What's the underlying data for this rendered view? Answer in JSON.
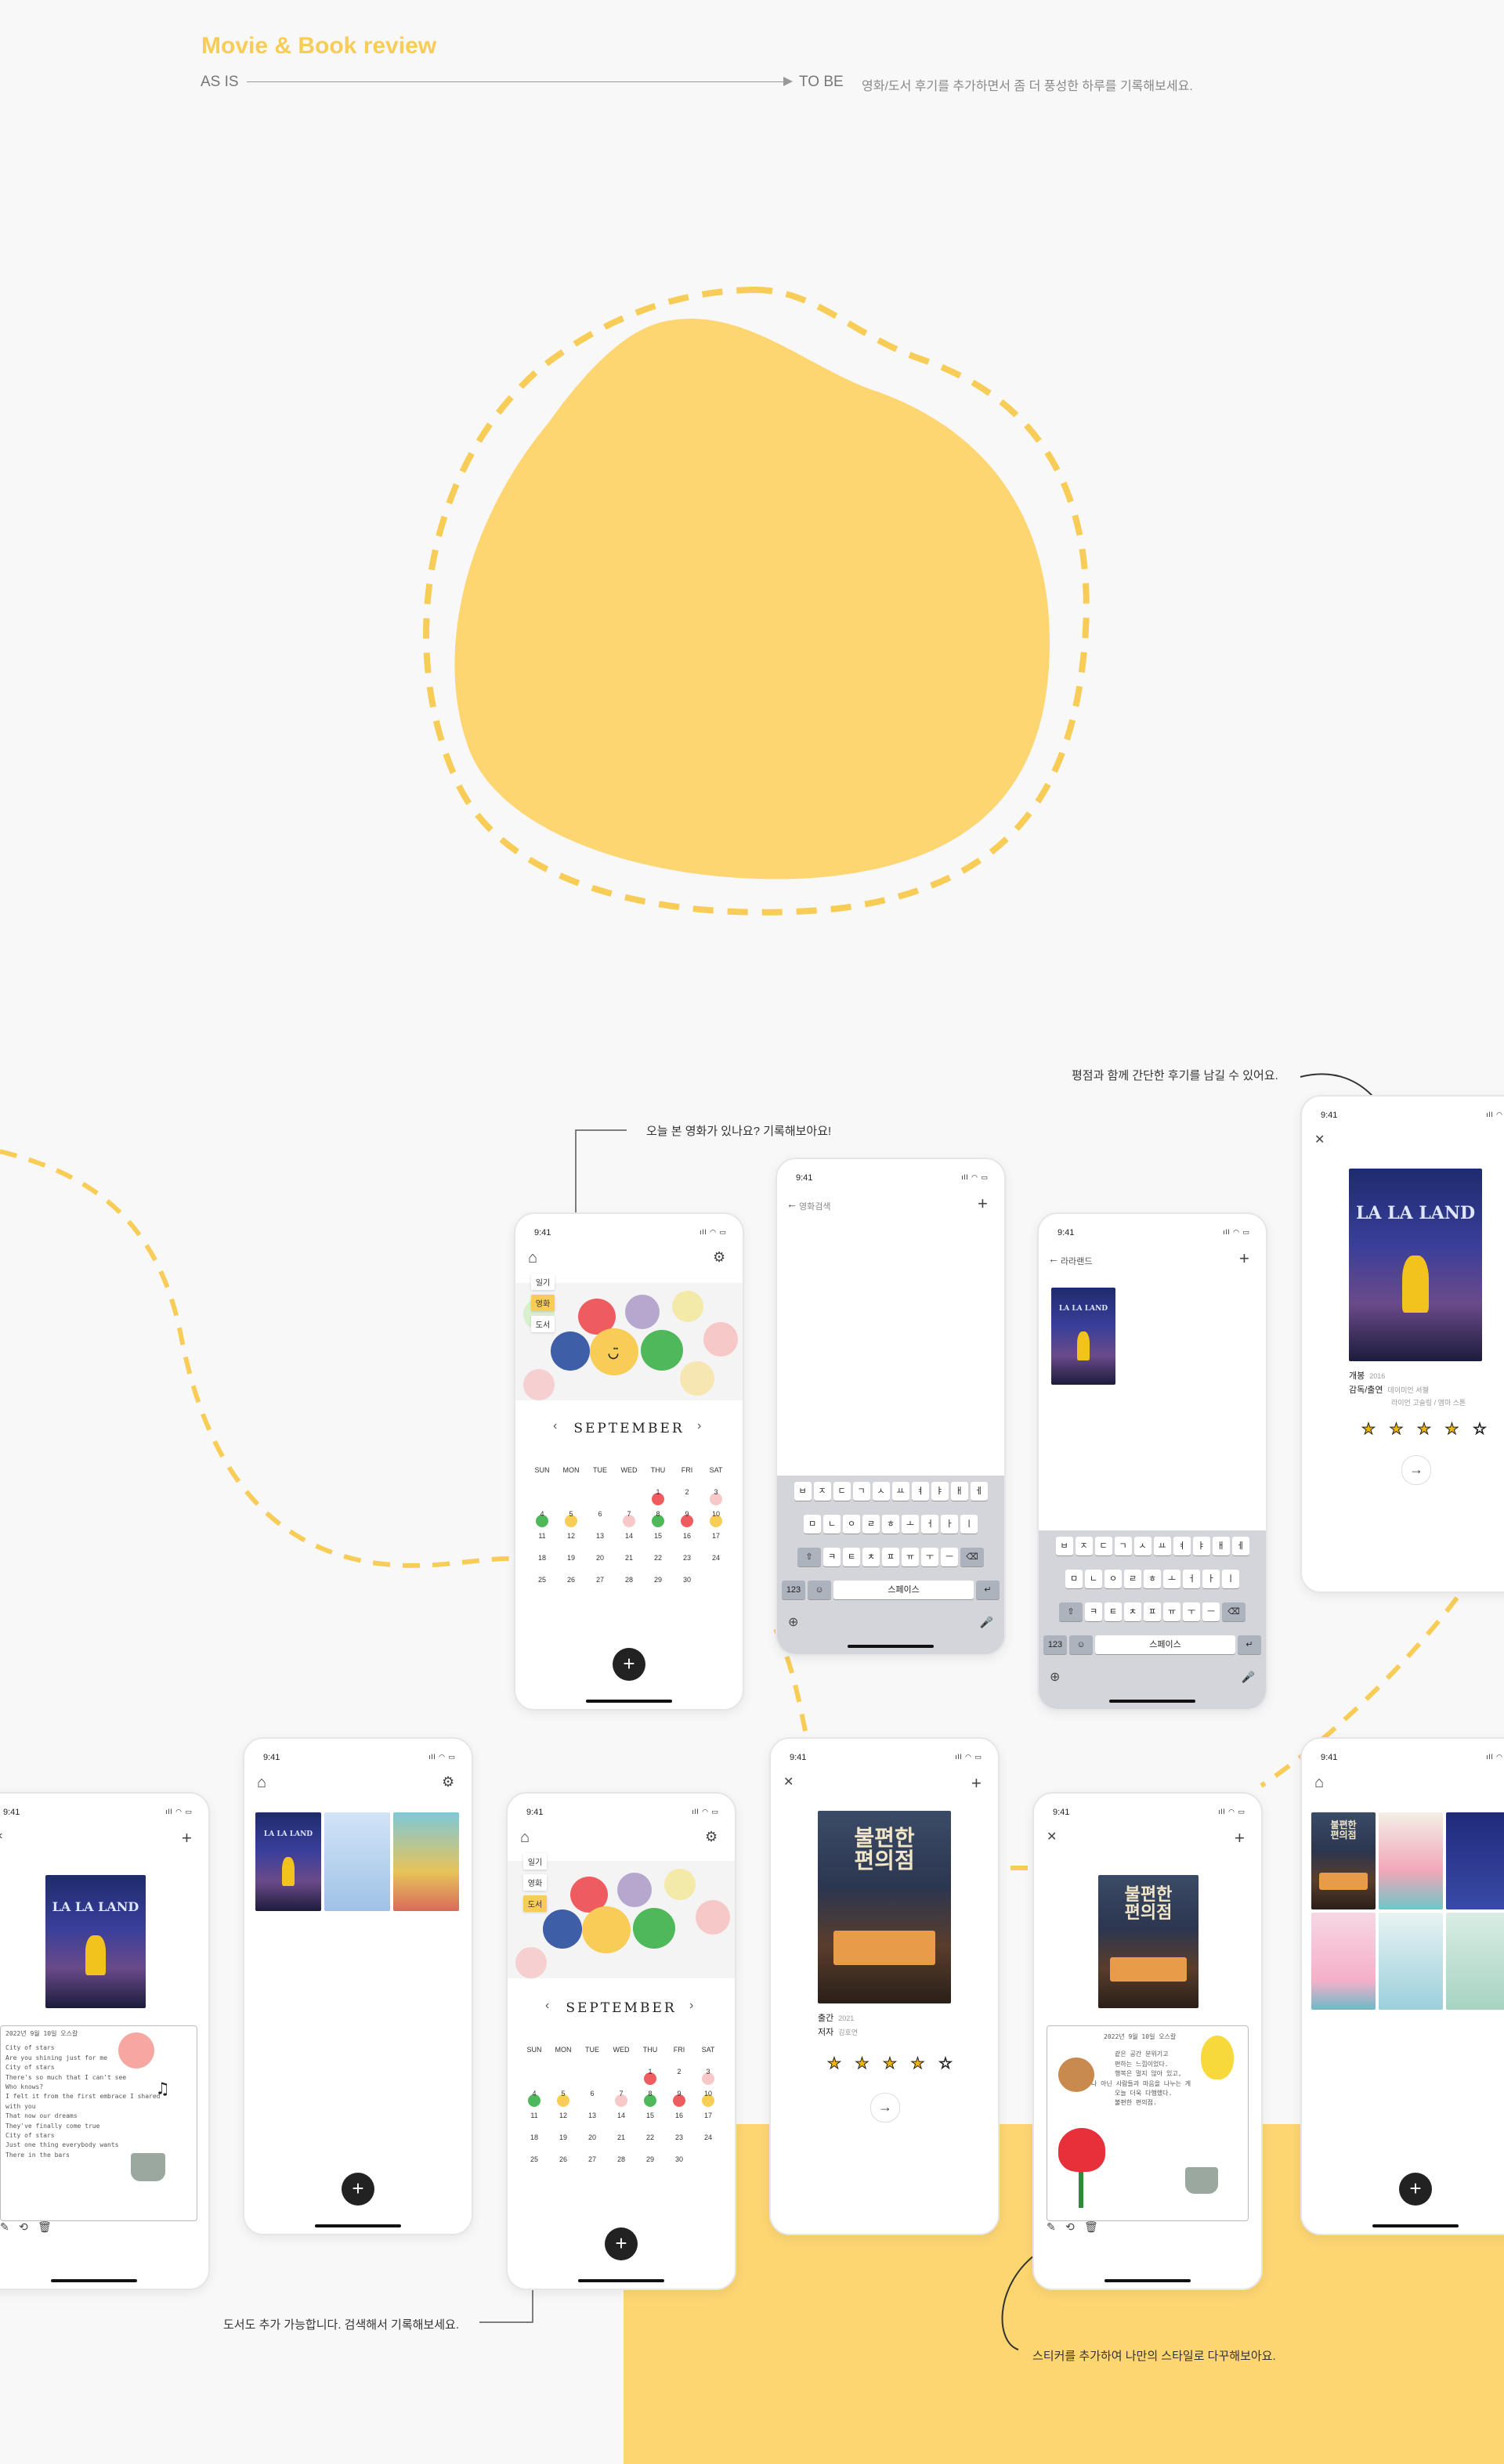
{
  "header": {
    "title": "Movie & Book review",
    "as_is": "AS IS",
    "to_be": "TO BE",
    "description": "영화/도서 후기를 추가하면서 좀 더 풍성한 하루를 기록해보세요."
  },
  "annotations": {
    "top_center": "오늘 본 영화가 있나요? 기록해보아요!",
    "top_right": "평점과 함께 간단한 후기를 남길 수 있어요.",
    "bottom_left": "도서도 추가 가능합니다. 검색해서 기록해보세요.",
    "bottom_right": "스티커를 추가하여 나만의 스타일로 다꾸해보아요."
  },
  "status": {
    "time": "9:41",
    "icons": "ıll ◠ ▭"
  },
  "calendar": {
    "month": "SEPTEMBER",
    "weekdays": [
      "SUN",
      "MON",
      "TUE",
      "WED",
      "THU",
      "FRI",
      "SAT"
    ],
    "weeks": [
      [
        "",
        "",
        "",
        "",
        "1",
        "2",
        "3"
      ],
      [
        "4",
        "5",
        "6",
        "7",
        "8",
        "9",
        "10"
      ],
      [
        "11",
        "12",
        "13",
        "14",
        "15",
        "16",
        "17"
      ],
      [
        "18",
        "19",
        "20",
        "21",
        "22",
        "23",
        "24"
      ],
      [
        "25",
        "26",
        "27",
        "28",
        "29",
        "30",
        ""
      ]
    ],
    "tabs": [
      "일기",
      "영화",
      "도서"
    ]
  },
  "search": {
    "movie_placeholder": "영화검색",
    "movie_query": "라라랜드"
  },
  "keyboard": {
    "row1": [
      "ㅂ",
      "ㅈ",
      "ㄷ",
      "ㄱ",
      "ㅅ",
      "ㅛ",
      "ㅕ",
      "ㅑ",
      "ㅐ",
      "ㅔ"
    ],
    "row2": [
      "ㅁ",
      "ㄴ",
      "ㅇ",
      "ㄹ",
      "ㅎ",
      "ㅗ",
      "ㅓ",
      "ㅏ",
      "ㅣ"
    ],
    "row3": [
      "⇧",
      "ㅋ",
      "ㅌ",
      "ㅊ",
      "ㅍ",
      "ㅠ",
      "ㅜ",
      "ㅡ",
      "⌫"
    ],
    "num": "123",
    "emoji": "☺",
    "space": "스페이스",
    "enter": "↵",
    "globe": "⊕",
    "mic": "🎤"
  },
  "movie": {
    "title_line": "LA LA LAND",
    "release_label": "개봉",
    "release_year": "2016",
    "cast_label": "감독/출연",
    "director": "데이미언 셔젤",
    "cast": "라이언 고슬링 / 엠마 스톤",
    "rating": "★ ★ ★ ★ ☆"
  },
  "book": {
    "title_line1": "불편한",
    "title_line2": "편의점",
    "published_label": "출간",
    "published_year": "2021",
    "author_label": "저자",
    "author": "김호연",
    "rating": "★ ★ ★ ★ ☆"
  },
  "diary": {
    "movie_date": "2022년 9월 10일 오스칼",
    "movie_lines": [
      "City of stars",
      "Are you shining just for me",
      "City of stars",
      "There's so much that I can't see",
      "Who knows?",
      "I felt it from the first embrace I shared",
      "with you",
      "That now our dreams",
      "They've finally come true",
      "City of stars",
      "Just one thing everybody wants",
      "There in the bars"
    ],
    "book_date": "2022년 9월 10일 오스칼",
    "book_lines": [
      "같은 공간 분위기고",
      "편하는 느낌이었다.",
      "행복은 멀지 않아 있고,",
      "나 아닌 사람들과 마음을 나누는 게",
      "오늘 더욱 다행했다.",
      "불편한 편의점."
    ]
  },
  "icons": {
    "home": "⌂",
    "chevron": "⌄",
    "filter": "⚙",
    "plus": "+",
    "close": "✕",
    "back": "←",
    "arrow_right": "→",
    "prev": "‹",
    "next": "›",
    "edit": "✎",
    "share": "⟲",
    "trash": "🗑"
  },
  "colors": {
    "accent": "#f7cc57",
    "yellow_bg": "#fdd672",
    "blob": "#fdd672"
  }
}
